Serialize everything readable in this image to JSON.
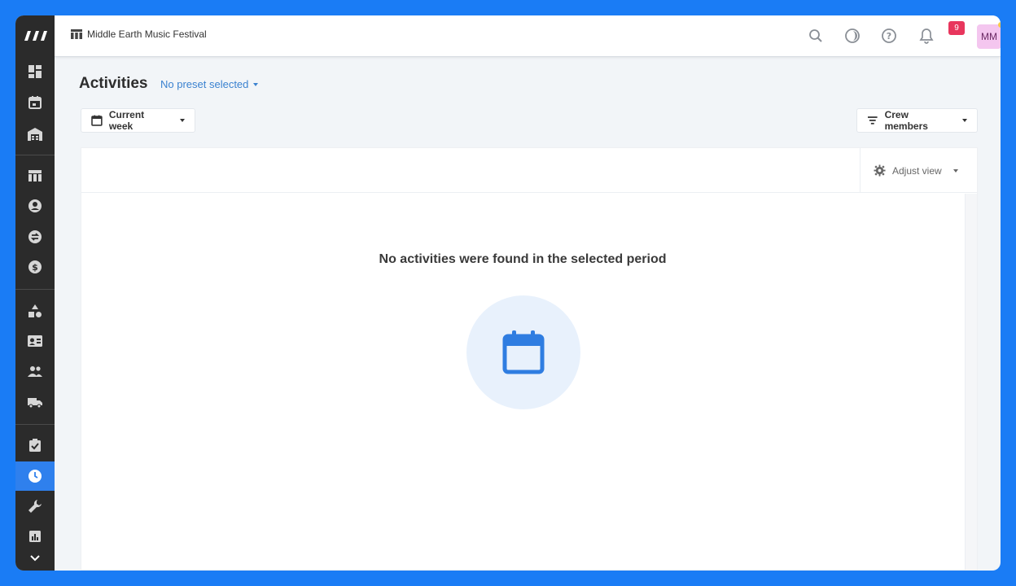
{
  "topbar": {
    "project_name": "Middle Earth Music Festival",
    "notification_count": "9",
    "avatar_initials": "MM",
    "user_name": "M M"
  },
  "page": {
    "title": "Activities",
    "preset_label": "No preset selected"
  },
  "toolbar": {
    "period_label": "Current week",
    "filter_label": "Crew members",
    "adjust_view_label": "Adjust view"
  },
  "empty_state": {
    "message": "No activities were found in the selected period"
  },
  "sidebar": {
    "items": [
      {
        "icon": "dashboard-icon"
      },
      {
        "icon": "calendar-icon"
      },
      {
        "icon": "warehouse-icon"
      },
      {
        "icon": "table-icon"
      },
      {
        "icon": "contact-icon"
      },
      {
        "icon": "swap-icon"
      },
      {
        "icon": "dollar-icon"
      },
      {
        "icon": "shapes-icon"
      },
      {
        "icon": "id-card-icon"
      },
      {
        "icon": "people-icon"
      },
      {
        "icon": "truck-icon"
      },
      {
        "icon": "clipboard-check-icon"
      },
      {
        "icon": "clock-icon",
        "active": true
      },
      {
        "icon": "wrench-icon"
      },
      {
        "icon": "report-icon"
      },
      {
        "icon": "chevron-down-icon"
      }
    ]
  },
  "colors": {
    "frame": "#1a7cf5",
    "sidebar": "#2b2b2b",
    "active": "#2f80ed",
    "accent_link": "#3b82d0",
    "badge": "#e8365d",
    "avatar_bg": "#f4c6ef",
    "empty_circle": "#e8f1fc"
  }
}
